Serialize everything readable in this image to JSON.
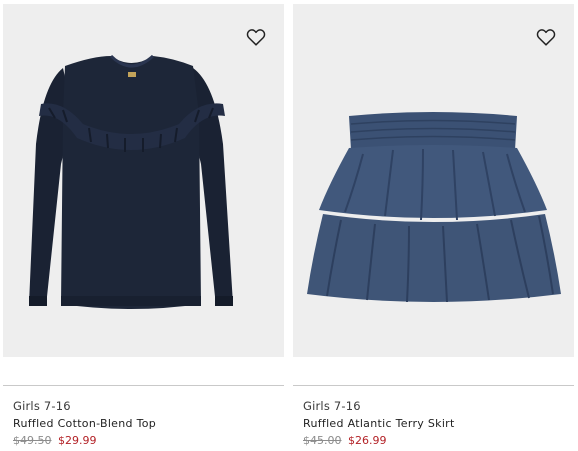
{
  "products": [
    {
      "category": "Girls 7-16",
      "name": "Ruffled Cotton-Blend Top",
      "original_price": "$49.50",
      "sale_price": "$29.99",
      "image_icon": "navy-ruffled-top-image"
    },
    {
      "category": "Girls 7-16",
      "name": "Ruffled Atlantic Terry Skirt",
      "original_price": "$45.00",
      "sale_price": "$26.99",
      "image_icon": "navy-tiered-skirt-image"
    }
  ],
  "colors": {
    "image_bg": "#eeeeee",
    "sale_price": "#b32227",
    "original_price": "#8c8c8c",
    "top_fabric": "#1d2638",
    "skirt_fabric": "#3f5577"
  }
}
